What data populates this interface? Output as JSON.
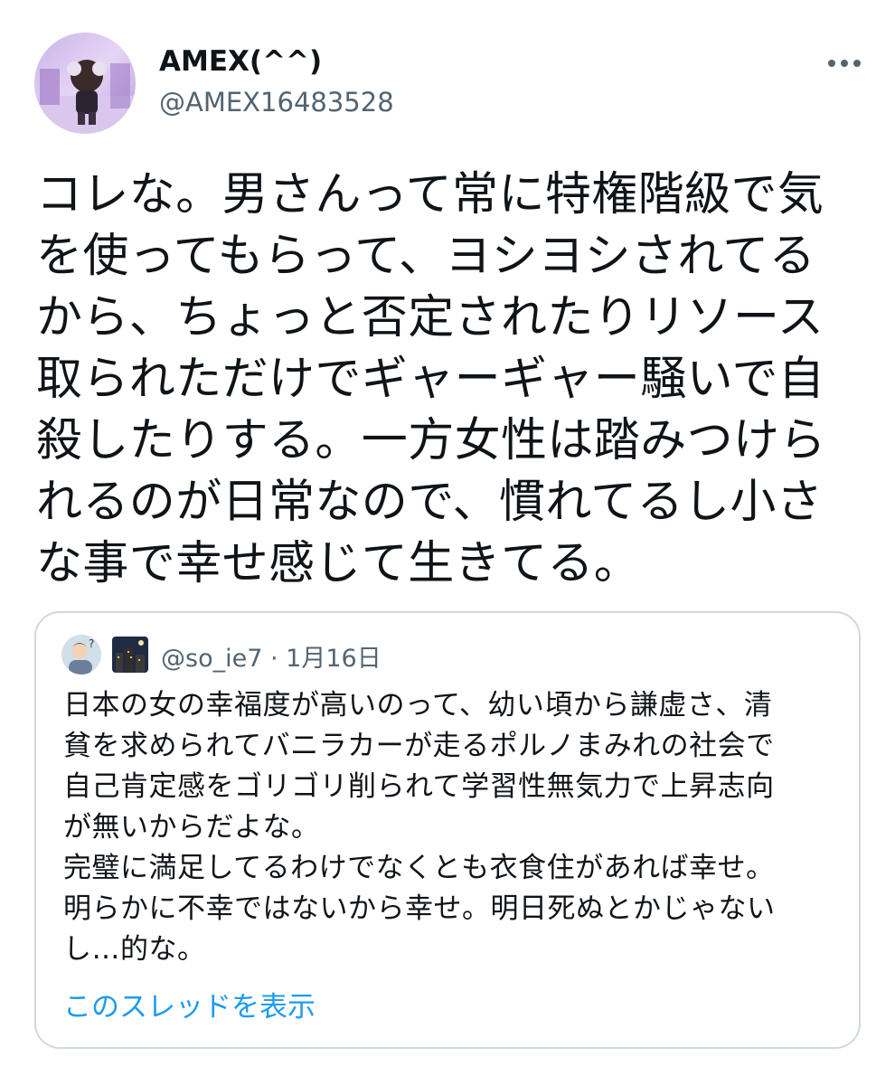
{
  "author": {
    "display_name": "AMEX(^^)",
    "handle": "@AMEX16483528",
    "avatar_icon": "profile-avatar-icon"
  },
  "more_icon": "more-horizontal-icon",
  "tweet": {
    "text": "コレな。男さんって常に特権階級で気\nを使ってもらって、ヨシヨシされてる\nから、ちょっと否定されたりリソース\n取られただけでギャーギャー騒いで自\n殺したりする。一方女性は踏みつけら\nれるのが日常なので、慣れてるし小さ\nな事で幸せ感じて生きてる。"
  },
  "quoted_tweet": {
    "avatar_icon": "quoted-user-avatar-icon",
    "emoji_icon": "night-city-emoji-icon",
    "handle": "@so_ie7",
    "separator": "·",
    "date": "1月16日",
    "text": "日本の女の幸福度が高いのって、幼い頃から謙虚さ、清\n貧を求められてバニラカーが走るポルノまみれの社会で\n自己肯定感をゴリゴリ削られて学習性無気力で上昇志向\nが無いからだよな。\n完璧に満足してるわけでなくとも衣食住があれば幸せ。\n明らかに不幸ではないから幸せ。明日死ぬとかじゃない\nし…的な。",
    "show_thread_label": "このスレッドを表示"
  },
  "colors": {
    "text_primary": "#0f1419",
    "text_secondary": "#536471",
    "link": "#1d9bf0",
    "border": "#cfd9de"
  }
}
